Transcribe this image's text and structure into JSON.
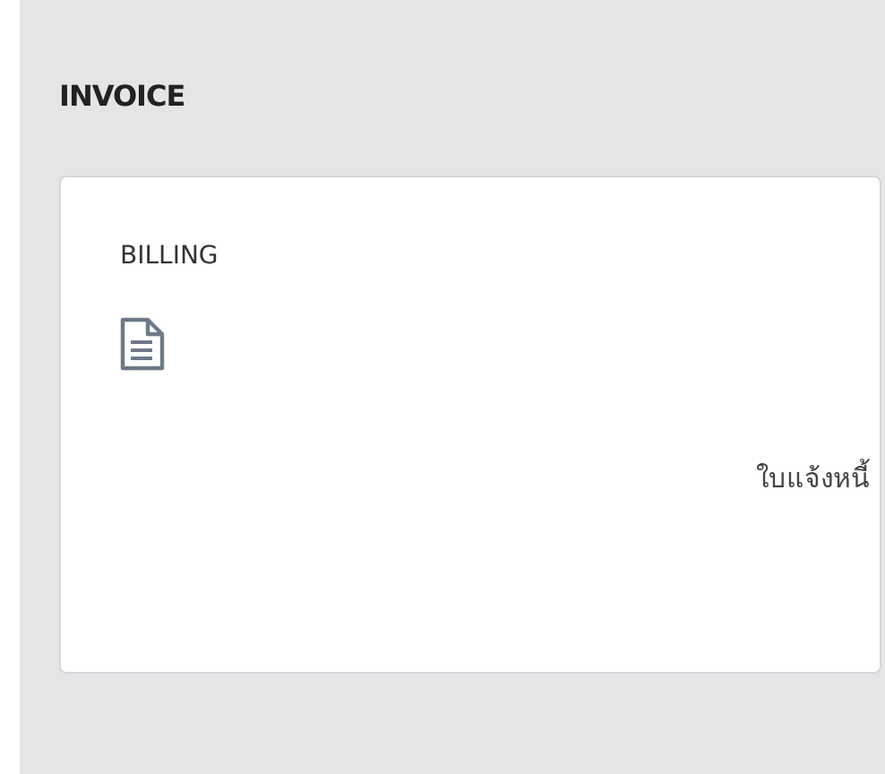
{
  "section": {
    "title": "INVOICE"
  },
  "card": {
    "title": "BILLING",
    "caption": "ใบแจ้งหนี้"
  }
}
